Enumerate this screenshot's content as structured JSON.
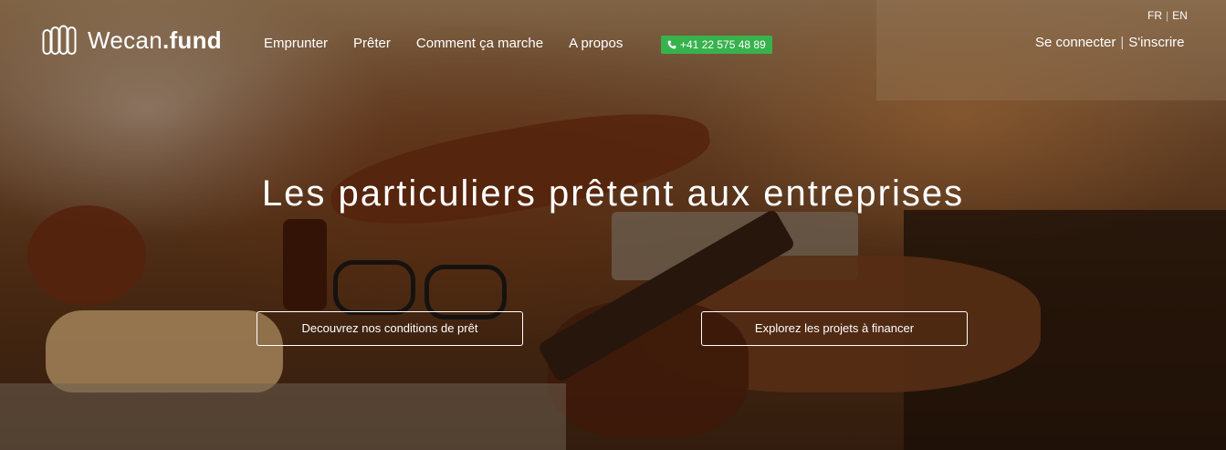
{
  "brand": {
    "name_light": "Wecan",
    "name_bold": ".fund"
  },
  "nav": {
    "items": [
      {
        "label": "Emprunter"
      },
      {
        "label": "Prêter"
      },
      {
        "label": "Comment ça marche"
      },
      {
        "label": "A propos"
      }
    ]
  },
  "phone": {
    "number": "+41 22 575 48 89",
    "icon": "phone-icon",
    "color": "#37b24d"
  },
  "lang": {
    "fr": "FR",
    "en": "EN",
    "separator": "|"
  },
  "auth": {
    "login": "Se connecter",
    "separator": "|",
    "signup": "S'inscrire"
  },
  "hero": {
    "title": "Les particuliers prêtent aux entreprises",
    "cta_left": "Decouvrez nos conditions de prêt",
    "cta_right": "Explorez les projets à financer"
  }
}
